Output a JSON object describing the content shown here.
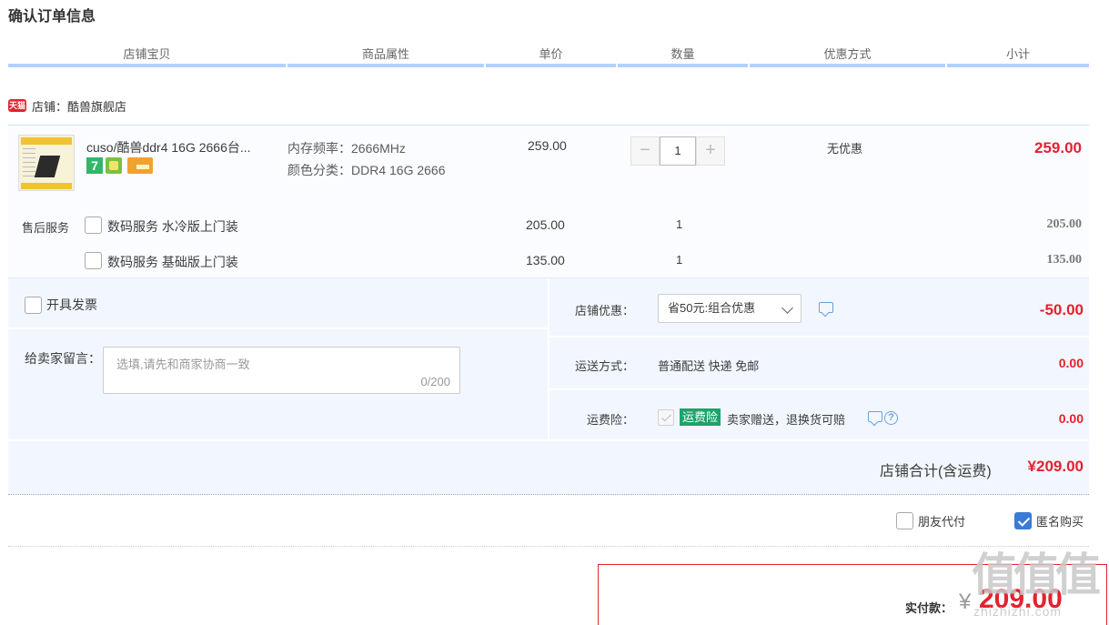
{
  "page_title": "确认订单信息",
  "columns": [
    "店铺宝贝",
    "商品属性",
    "单价",
    "数量",
    "优惠方式",
    "小计"
  ],
  "shop": {
    "badge": "天猫",
    "label": "店铺：",
    "name": "酷兽旗舰店"
  },
  "item": {
    "title": "cuso/酷兽ddr4 16G 2666台...",
    "attributes": [
      {
        "label": "内存频率：",
        "value": "2666MHz"
      },
      {
        "label": "颜色分类：",
        "value": "DDR4 16G 2666"
      }
    ],
    "badge_seven": "7",
    "unit_price": "259.00",
    "qty_minus": "−",
    "quantity": "1",
    "qty_plus": "+",
    "discount": "无优惠",
    "subtotal": "259.00"
  },
  "after_sales": {
    "label": "售后服务",
    "services": [
      {
        "name": "数码服务 水冷版上门装",
        "price": "205.00",
        "qty": "1",
        "subtotal": "205.00",
        "checked": false
      },
      {
        "name": "数码服务 基础版上门装",
        "price": "135.00",
        "qty": "1",
        "subtotal": "135.00",
        "checked": false
      }
    ]
  },
  "invoice": {
    "label": "开具发票",
    "checked": false
  },
  "message": {
    "label": "给卖家留言：",
    "placeholder": "选填,请先和商家协商一致",
    "counter": "0/200"
  },
  "shop_coupon": {
    "label": "店铺优惠：",
    "selected": "省50元:组合优惠",
    "amount": "-50.00"
  },
  "shipping": {
    "label": "运送方式：",
    "value": "普通配送 快递 免邮",
    "amount": "0.00"
  },
  "insurance": {
    "label": "运费险：",
    "tag": "运费险",
    "text": "卖家赠送，退换货可赔",
    "help": "?",
    "amount": "0.00"
  },
  "shop_total": {
    "label": "店铺合计(含运费)",
    "amount": "¥209.00"
  },
  "options": {
    "friend_pay": "朋友代付",
    "friend_pay_checked": false,
    "anonymous": "匿名购买",
    "anonymous_checked": true
  },
  "payment": {
    "label": "实付款：",
    "currency": "¥",
    "amount": "209.00"
  },
  "watermark": {
    "main": "值值值",
    "sub": "zhizhizhi.com"
  },
  "colors": {
    "accent_red": "#e4222e",
    "header_underline": "#b2d1ff",
    "panel_bg": "#f2f7ff",
    "insurance_green": "#1da36b",
    "checkbox_blue": "#3a7bd5"
  }
}
